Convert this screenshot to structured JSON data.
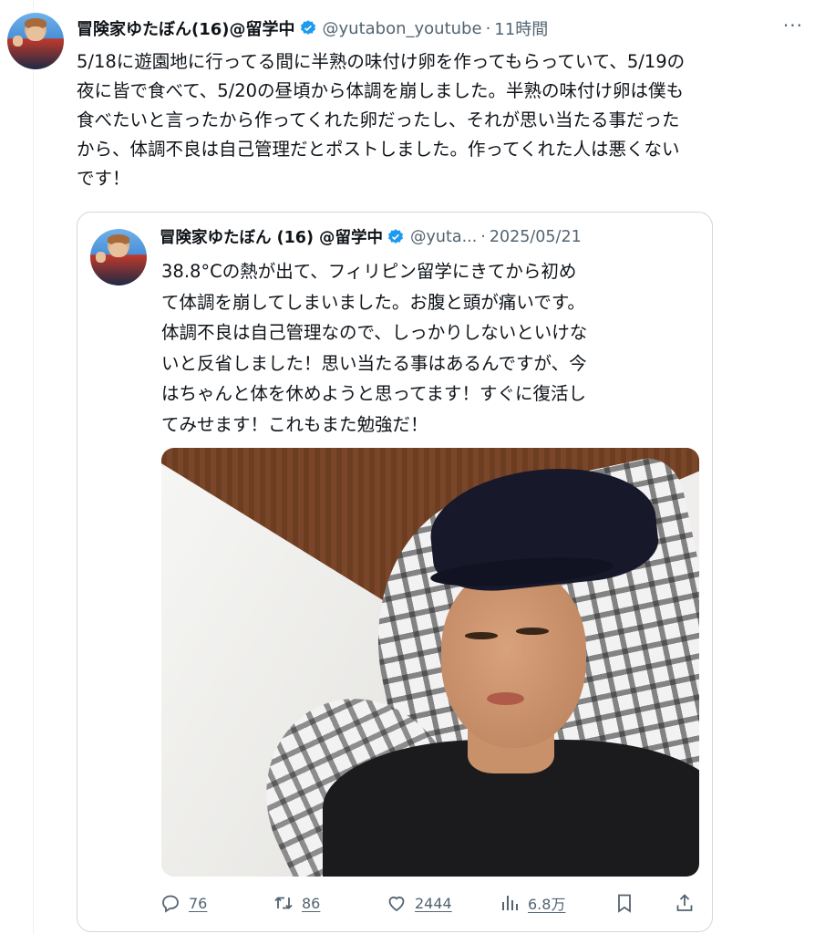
{
  "tweet": {
    "display_name": "冒険家ゆたぼん(16)@留学中",
    "handle": "@yutabon_youtube",
    "separator": "·",
    "time": "11時間",
    "more": "···",
    "text": "5/18に遊園地に行ってる間に半熟の味付け卵を作ってもらっていて、5/19の\n夜に皆で食べて、5/20の昼頃から体調を崩しました。半熟の味付け卵は僕も\n食べたいと言ったから作ってくれた卵だったし、それが思い当たる事だった\nから、体調不良は自己管理だとポストしました。作ってくれた人は悪くない\nです！"
  },
  "quoted": {
    "display_name": "冒険家ゆたぼん (16) @留学中",
    "handle": "@yuta...",
    "separator": "·",
    "date": "2025/05/21",
    "text": "38.8°Cの熱が出て、フィリピン留学にきてから初め\nて体調を崩してしまいました。お腹と頭が痛いです。\n体調不良は自己管理なので、しっかりしないといけな\nいと反省しました！思い当たる事はあるんですが、今\nはちゃんと体を休めようと思ってます！すぐに復活し\nてみせます！これもまた勉強だ！"
  },
  "actions": {
    "replies": "76",
    "reposts": "86",
    "likes": "2444",
    "views": "6.8万"
  },
  "icons": {
    "verified": "verified-badge-icon",
    "reply": "reply-icon",
    "repost": "repost-icon",
    "like": "heart-icon",
    "views": "views-icon",
    "bookmark": "bookmark-icon",
    "share": "share-icon"
  },
  "colors": {
    "verified": "#1d9bf0",
    "secondary_text": "#536471",
    "border": "#cfd9de"
  }
}
